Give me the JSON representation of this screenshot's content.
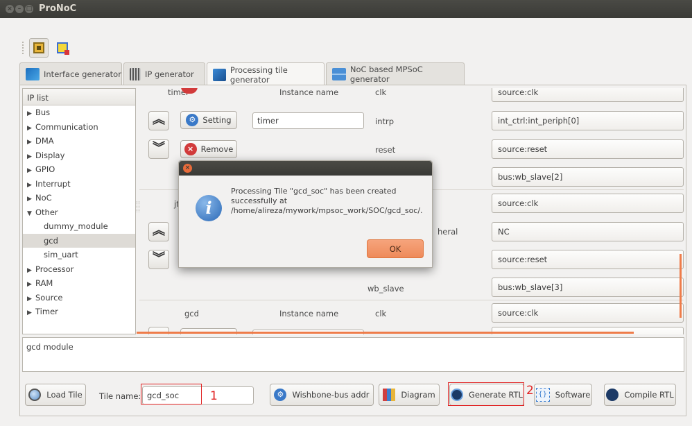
{
  "window": {
    "title": "ProNoC"
  },
  "tabs": [
    {
      "label": "Interface generator"
    },
    {
      "label": "IP generator"
    },
    {
      "label": "Processing tile generator"
    },
    {
      "label": "NoC based MPSoC generator"
    }
  ],
  "iplist": {
    "header": "IP list",
    "items": [
      {
        "label": "Bus",
        "arrow": "▶"
      },
      {
        "label": "Communication",
        "arrow": "▶"
      },
      {
        "label": "DMA",
        "arrow": "▶"
      },
      {
        "label": "Display",
        "arrow": "▶"
      },
      {
        "label": "GPIO",
        "arrow": "▶"
      },
      {
        "label": "Interrupt",
        "arrow": "▶"
      },
      {
        "label": "NoC",
        "arrow": "▶"
      },
      {
        "label": "Other",
        "arrow": "▼"
      },
      {
        "label": "dummy_module",
        "arrow": ""
      },
      {
        "label": "gcd",
        "arrow": ""
      },
      {
        "label": "sim_uart",
        "arrow": ""
      },
      {
        "label": "Processor",
        "arrow": "▶"
      },
      {
        "label": "RAM",
        "arrow": "▶"
      },
      {
        "label": "Source",
        "arrow": "▶"
      },
      {
        "label": "Timer",
        "arrow": "▶"
      }
    ]
  },
  "panel": {
    "timer_name": "timer",
    "instance_label": "Instance name",
    "setting": "Setting",
    "remove": "Remove",
    "instance_value": "timer",
    "ports": {
      "clk": "clk",
      "intrp": "intrp",
      "reset": "reset",
      "heral": "heral",
      "wb_slave": "wb_slave"
    },
    "jt_partial": "jt",
    "gcd_name": "gcd",
    "combos": [
      "source:clk",
      "int_ctrl:int_periph[0]",
      "source:reset",
      "bus:wb_slave[2]",
      "source:clk",
      "NC",
      "source:reset",
      "bus:wb_slave[3]",
      "source:clk"
    ]
  },
  "description": "gcd module",
  "bottom": {
    "load_tile": "Load Tile",
    "tile_name_label": "Tile name:",
    "tile_name_value": "gcd_soc",
    "wishbone": "Wishbone-bus addr",
    "diagram": "Diagram",
    "generate_rtl": "Generate RTL",
    "software": "Software",
    "compile_rtl": "Compile RTL",
    "mark1": "1",
    "mark2": "2"
  },
  "dialog": {
    "message": "Processing Tile \"gcd_soc\" has been created successfully at /home/alireza/mywork/mpsoc_work/SOC/gcd_soc/.",
    "ok": "OK"
  }
}
